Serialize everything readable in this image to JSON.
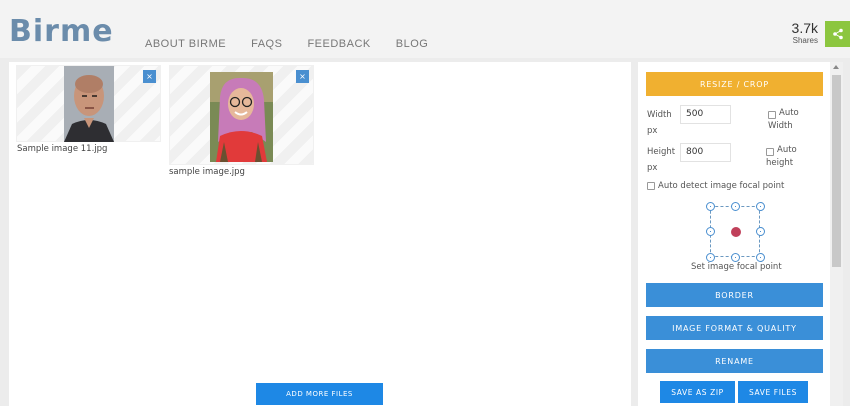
{
  "header": {
    "logo": "Birme",
    "nav": [
      "ABOUT BIRME",
      "FAQS",
      "FEEDBACK",
      "BLOG"
    ],
    "shares_count": "3.7k",
    "shares_label": "Shares"
  },
  "files": [
    {
      "caption": "Sample image 11.jpg",
      "close": "×"
    },
    {
      "caption": "sample image.jpg",
      "close": "×"
    }
  ],
  "add_more": "ADD MORE FILES",
  "panel": {
    "resize_crop": "RESIZE / CROP",
    "width_label_1": "Width",
    "width_label_2": "px",
    "width_value": "500",
    "auto_width_1": "Auto",
    "auto_width_2": "Width",
    "height_label_1": "Height",
    "height_label_2": "px",
    "height_value": "800",
    "auto_height_1": "Auto",
    "auto_height_2": "height",
    "auto_detect": "Auto detect image focal point",
    "focal_label": "Set image focal point",
    "border": "BORDER",
    "format_quality": "IMAGE FORMAT & QUALITY",
    "rename": "RENAME",
    "save_zip": "SAVE AS ZIP",
    "save_files": "SAVE FILES"
  },
  "colors": {
    "accent_blue": "#1e88e5",
    "accent_orange": "#f0b030",
    "share_green": "#8cc63f"
  }
}
